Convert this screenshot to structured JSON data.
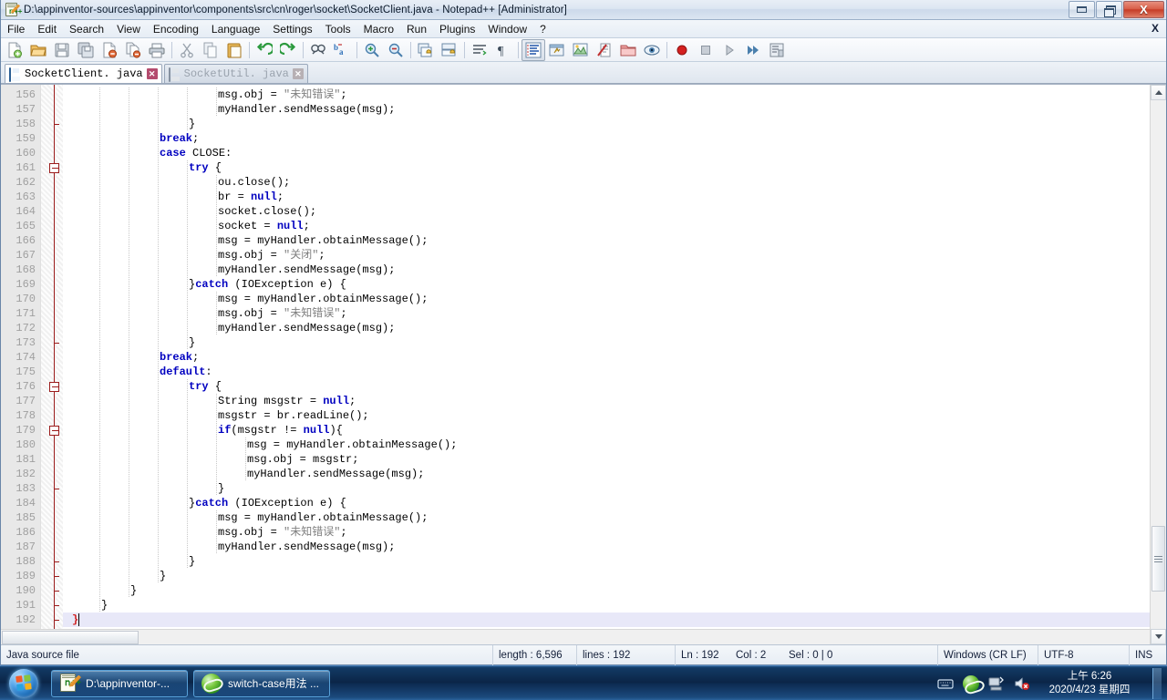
{
  "window": {
    "title": "D:\\appinventor-sources\\appinventor\\components\\src\\cn\\roger\\socket\\SocketClient.java - Notepad++ [Administrator]",
    "icon": "notepad-plus-plus-icon",
    "buttons": {
      "minimize": "–",
      "restore": "❐",
      "close": "X"
    }
  },
  "menubar": {
    "items": [
      "File",
      "Edit",
      "Search",
      "View",
      "Encoding",
      "Language",
      "Settings",
      "Tools",
      "Macro",
      "Run",
      "Plugins",
      "Window",
      "?"
    ],
    "close_doc": "X"
  },
  "toolbar": {
    "groups": [
      [
        "new-file-icon",
        "open-file-icon",
        "save-icon",
        "save-all-icon",
        "close-file-icon",
        "close-all-icon",
        "print-icon"
      ],
      [
        "cut-icon",
        "copy-icon",
        "paste-icon"
      ],
      [
        "undo-icon",
        "redo-icon"
      ],
      [
        "find-icon",
        "replace-icon"
      ],
      [
        "zoom-in-icon",
        "zoom-out-icon"
      ],
      [
        "sync-vertical-scroll-icon",
        "sync-horizontal-scroll-icon"
      ],
      [
        "word-wrap-icon",
        "show-all-characters-icon"
      ],
      [
        "indent-guide-icon",
        "user-defined-dialog-icon",
        "show-document-map-icon",
        "show-function-list-icon",
        "show-folder-as-workspace-icon",
        "document-preview-icon"
      ],
      [
        "record-macro-icon",
        "stop-recording-icon",
        "play-macro-icon",
        "run-macro-multiple-icon",
        "save-macro-icon"
      ]
    ],
    "active_button": "indent-guide-icon"
  },
  "tabs": [
    {
      "label": "SocketClient. java",
      "active": true,
      "close": "✕",
      "icon": "saved-file-icon"
    },
    {
      "label": "SocketUtil. java",
      "active": false,
      "close": "✕",
      "icon": "saved-file-icon"
    }
  ],
  "editor": {
    "first_line": 156,
    "current_line": 192,
    "lines": [
      {
        "n": 156,
        "indent": 5,
        "tokens": [
          {
            "t": "msg.obj = ",
            "c": "plain"
          },
          {
            "t": "\"未知错误\"",
            "c": "str"
          },
          {
            "t": ";",
            "c": "plain"
          }
        ]
      },
      {
        "n": 157,
        "indent": 5,
        "tokens": [
          {
            "t": "myHandler.sendMessage(msg);",
            "c": "plain"
          }
        ]
      },
      {
        "n": 158,
        "indent": 4,
        "tokens": [
          {
            "t": "}",
            "c": "plain"
          }
        ]
      },
      {
        "n": 159,
        "indent": 3,
        "tokens": [
          {
            "t": "break",
            "c": "kw"
          },
          {
            "t": ";",
            "c": "plain"
          }
        ]
      },
      {
        "n": 160,
        "indent": 3,
        "tokens": [
          {
            "t": "case",
            "c": "kw"
          },
          {
            "t": " CLOSE:",
            "c": "plain"
          }
        ]
      },
      {
        "n": 161,
        "indent": 4,
        "tokens": [
          {
            "t": "try",
            "c": "kw"
          },
          {
            "t": " {",
            "c": "plain"
          }
        ]
      },
      {
        "n": 162,
        "indent": 5,
        "tokens": [
          {
            "t": "ou.close();",
            "c": "plain"
          }
        ]
      },
      {
        "n": 163,
        "indent": 5,
        "tokens": [
          {
            "t": "br = ",
            "c": "plain"
          },
          {
            "t": "null",
            "c": "kw"
          },
          {
            "t": ";",
            "c": "plain"
          }
        ]
      },
      {
        "n": 164,
        "indent": 5,
        "tokens": [
          {
            "t": "socket.close();",
            "c": "plain"
          }
        ]
      },
      {
        "n": 165,
        "indent": 5,
        "tokens": [
          {
            "t": "socket = ",
            "c": "plain"
          },
          {
            "t": "null",
            "c": "kw"
          },
          {
            "t": ";",
            "c": "plain"
          }
        ]
      },
      {
        "n": 166,
        "indent": 5,
        "tokens": [
          {
            "t": "msg = myHandler.obtainMessage();",
            "c": "plain"
          }
        ]
      },
      {
        "n": 167,
        "indent": 5,
        "tokens": [
          {
            "t": "msg.obj = ",
            "c": "plain"
          },
          {
            "t": "\"关闭\"",
            "c": "str"
          },
          {
            "t": ";",
            "c": "plain"
          }
        ]
      },
      {
        "n": 168,
        "indent": 5,
        "tokens": [
          {
            "t": "myHandler.sendMessage(msg);",
            "c": "plain"
          }
        ]
      },
      {
        "n": 169,
        "indent": 4,
        "tokens": [
          {
            "t": "}",
            "c": "plain"
          },
          {
            "t": "catch",
            "c": "kw"
          },
          {
            "t": " (IOException e) {",
            "c": "plain"
          }
        ]
      },
      {
        "n": 170,
        "indent": 5,
        "tokens": [
          {
            "t": "msg = myHandler.obtainMessage();",
            "c": "plain"
          }
        ]
      },
      {
        "n": 171,
        "indent": 5,
        "tokens": [
          {
            "t": "msg.obj = ",
            "c": "plain"
          },
          {
            "t": "\"未知错误\"",
            "c": "str"
          },
          {
            "t": ";",
            "c": "plain"
          }
        ]
      },
      {
        "n": 172,
        "indent": 5,
        "tokens": [
          {
            "t": "myHandler.sendMessage(msg);",
            "c": "plain"
          }
        ]
      },
      {
        "n": 173,
        "indent": 4,
        "tokens": [
          {
            "t": "}",
            "c": "plain"
          }
        ]
      },
      {
        "n": 174,
        "indent": 3,
        "tokens": [
          {
            "t": "break",
            "c": "kw"
          },
          {
            "t": ";",
            "c": "plain"
          }
        ]
      },
      {
        "n": 175,
        "indent": 3,
        "tokens": [
          {
            "t": "default",
            "c": "kw"
          },
          {
            "t": ":",
            "c": "plain"
          }
        ]
      },
      {
        "n": 176,
        "indent": 4,
        "tokens": [
          {
            "t": "try",
            "c": "kw"
          },
          {
            "t": " {",
            "c": "plain"
          }
        ]
      },
      {
        "n": 177,
        "indent": 5,
        "tokens": [
          {
            "t": "String msgstr = ",
            "c": "plain"
          },
          {
            "t": "null",
            "c": "kw"
          },
          {
            "t": ";",
            "c": "plain"
          }
        ]
      },
      {
        "n": 178,
        "indent": 5,
        "tokens": [
          {
            "t": "msgstr = br.readLine();",
            "c": "plain"
          }
        ]
      },
      {
        "n": 179,
        "indent": 5,
        "tokens": [
          {
            "t": "if",
            "c": "kw"
          },
          {
            "t": "(msgstr != ",
            "c": "plain"
          },
          {
            "t": "null",
            "c": "kw"
          },
          {
            "t": "){",
            "c": "plain"
          }
        ]
      },
      {
        "n": 180,
        "indent": 6,
        "tokens": [
          {
            "t": "msg = myHandler.obtainMessage();",
            "c": "plain"
          }
        ]
      },
      {
        "n": 181,
        "indent": 6,
        "tokens": [
          {
            "t": "msg.obj = msgstr;",
            "c": "plain"
          }
        ]
      },
      {
        "n": 182,
        "indent": 6,
        "tokens": [
          {
            "t": "myHandler.sendMessage(msg);",
            "c": "plain"
          }
        ]
      },
      {
        "n": 183,
        "indent": 5,
        "tokens": [
          {
            "t": "}",
            "c": "plain"
          }
        ]
      },
      {
        "n": 184,
        "indent": 4,
        "tokens": [
          {
            "t": "}",
            "c": "plain"
          },
          {
            "t": "catch",
            "c": "kw"
          },
          {
            "t": " (IOException e) {",
            "c": "plain"
          }
        ]
      },
      {
        "n": 185,
        "indent": 5,
        "tokens": [
          {
            "t": "msg = myHandler.obtainMessage();",
            "c": "plain"
          }
        ]
      },
      {
        "n": 186,
        "indent": 5,
        "tokens": [
          {
            "t": "msg.obj = ",
            "c": "plain"
          },
          {
            "t": "\"未知错误\"",
            "c": "str"
          },
          {
            "t": ";",
            "c": "plain"
          }
        ]
      },
      {
        "n": 187,
        "indent": 5,
        "tokens": [
          {
            "t": "myHandler.sendMessage(msg);",
            "c": "plain"
          }
        ]
      },
      {
        "n": 188,
        "indent": 4,
        "tokens": [
          {
            "t": "}",
            "c": "plain"
          }
        ]
      },
      {
        "n": 189,
        "indent": 3,
        "tokens": [
          {
            "t": "}",
            "c": "plain"
          }
        ]
      },
      {
        "n": 190,
        "indent": 2,
        "tokens": [
          {
            "t": "}",
            "c": "plain"
          }
        ]
      },
      {
        "n": 191,
        "indent": 1,
        "tokens": [
          {
            "t": "}",
            "c": "plain"
          }
        ]
      },
      {
        "n": 192,
        "indent": 0,
        "tokens": [
          {
            "t": "}",
            "c": "brace-hl"
          }
        ]
      }
    ],
    "fold_boxes": [
      161,
      176,
      179
    ],
    "fold_ticks": [
      158,
      173,
      183,
      188,
      189,
      190,
      191
    ],
    "fold_end": 192
  },
  "statusbar": {
    "filetype": "Java source file",
    "length": "length : 6,596",
    "lines": "lines : 192",
    "ln": "Ln : 192",
    "col": "Col : 2",
    "sel": "Sel : 0 | 0",
    "eol": "Windows (CR LF)",
    "encoding": "UTF-8",
    "insert_mode": "INS"
  },
  "taskbar": {
    "start": "start-orb-icon",
    "buttons": [
      {
        "label": "D:\\appinventor-...",
        "icon": "notepad-plus-plus-icon"
      },
      {
        "label": "switch-case用法 ...",
        "icon": "internet-explorer-icon"
      }
    ],
    "tray": [
      "keyboard-language-icon",
      "internet-explorer-icon",
      "network-icon",
      "volume-muted-icon"
    ],
    "clock": {
      "time": "上午 6:26",
      "date": "2020/4/23 星期四"
    }
  }
}
